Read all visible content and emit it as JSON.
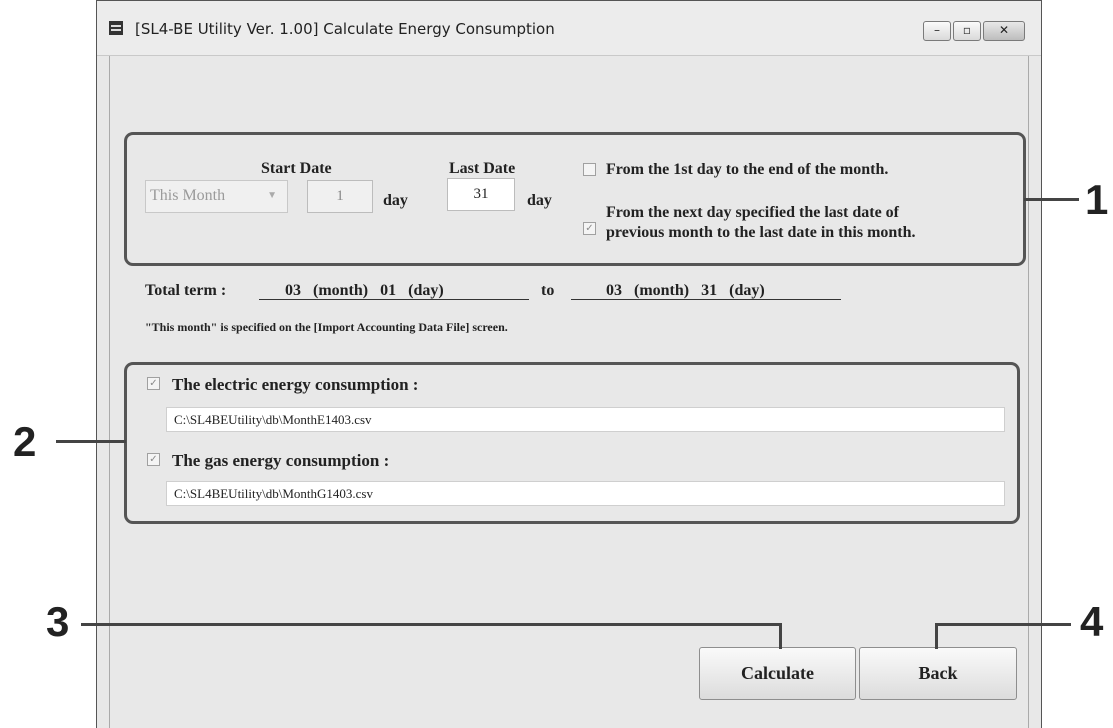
{
  "window": {
    "title": "[SL4-BE Utility Ver. 1.00]   Calculate Energy Consumption",
    "minimize_glyph": "–",
    "maximize_glyph": "▫",
    "close_glyph": "✕"
  },
  "date_range": {
    "start_date_label": "Start Date",
    "last_date_label": "Last Date",
    "month_select": "This Month",
    "start_day": "1",
    "last_day": "31",
    "day_unit": "day",
    "option_full_month": {
      "label": "From the 1st day to the end of the month.",
      "checked": false
    },
    "option_next_day_line1": "From the next day specified the last date of",
    "option_next_day_line2": "previous month to the last date in this month.",
    "option_next_day_checked": true
  },
  "total_term": {
    "label": "Total term :",
    "from": "03   (month)   01   (day)",
    "to_label": "to",
    "to": "03   (month)   31   (day)"
  },
  "note": "\"This month\" is specified on the [Import Accounting Data File] screen.",
  "outputs": {
    "electric_label": "The electric energy consumption :",
    "electric_checked": true,
    "electric_path": "C:\\SL4BEUtility\\db\\MonthE1403.csv",
    "gas_label": "The gas energy consumption :",
    "gas_checked": true,
    "gas_path": "C:\\SL4BEUtility\\db\\MonthG1403.csv"
  },
  "buttons": {
    "calculate": "Calculate",
    "back": "Back"
  },
  "callouts": [
    "1",
    "2",
    "3",
    "4"
  ],
  "check_glyph": "✓"
}
